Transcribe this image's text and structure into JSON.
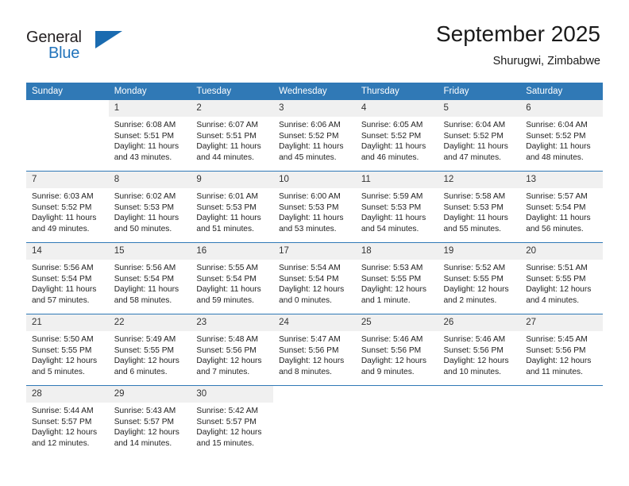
{
  "brand": {
    "name_top": "General",
    "name_bottom": "Blue",
    "color_black": "#231f20",
    "color_blue": "#2173bb"
  },
  "header": {
    "title": "September 2025",
    "subtitle": "Shurugwi, Zimbabwe"
  },
  "theme": {
    "header_bg": "#3079b6",
    "daynum_bg": "#f0f0f0",
    "grid_line": "#3079b6"
  },
  "weekday_headers": [
    "Sunday",
    "Monday",
    "Tuesday",
    "Wednesday",
    "Thursday",
    "Friday",
    "Saturday"
  ],
  "weeks": [
    [
      {
        "day": "",
        "sunrise": "",
        "sunset": "",
        "daylight1": "",
        "daylight2": ""
      },
      {
        "day": "1",
        "sunrise": "Sunrise: 6:08 AM",
        "sunset": "Sunset: 5:51 PM",
        "daylight1": "Daylight: 11 hours",
        "daylight2": "and 43 minutes."
      },
      {
        "day": "2",
        "sunrise": "Sunrise: 6:07 AM",
        "sunset": "Sunset: 5:51 PM",
        "daylight1": "Daylight: 11 hours",
        "daylight2": "and 44 minutes."
      },
      {
        "day": "3",
        "sunrise": "Sunrise: 6:06 AM",
        "sunset": "Sunset: 5:52 PM",
        "daylight1": "Daylight: 11 hours",
        "daylight2": "and 45 minutes."
      },
      {
        "day": "4",
        "sunrise": "Sunrise: 6:05 AM",
        "sunset": "Sunset: 5:52 PM",
        "daylight1": "Daylight: 11 hours",
        "daylight2": "and 46 minutes."
      },
      {
        "day": "5",
        "sunrise": "Sunrise: 6:04 AM",
        "sunset": "Sunset: 5:52 PM",
        "daylight1": "Daylight: 11 hours",
        "daylight2": "and 47 minutes."
      },
      {
        "day": "6",
        "sunrise": "Sunrise: 6:04 AM",
        "sunset": "Sunset: 5:52 PM",
        "daylight1": "Daylight: 11 hours",
        "daylight2": "and 48 minutes."
      }
    ],
    [
      {
        "day": "7",
        "sunrise": "Sunrise: 6:03 AM",
        "sunset": "Sunset: 5:52 PM",
        "daylight1": "Daylight: 11 hours",
        "daylight2": "and 49 minutes."
      },
      {
        "day": "8",
        "sunrise": "Sunrise: 6:02 AM",
        "sunset": "Sunset: 5:53 PM",
        "daylight1": "Daylight: 11 hours",
        "daylight2": "and 50 minutes."
      },
      {
        "day": "9",
        "sunrise": "Sunrise: 6:01 AM",
        "sunset": "Sunset: 5:53 PM",
        "daylight1": "Daylight: 11 hours",
        "daylight2": "and 51 minutes."
      },
      {
        "day": "10",
        "sunrise": "Sunrise: 6:00 AM",
        "sunset": "Sunset: 5:53 PM",
        "daylight1": "Daylight: 11 hours",
        "daylight2": "and 53 minutes."
      },
      {
        "day": "11",
        "sunrise": "Sunrise: 5:59 AM",
        "sunset": "Sunset: 5:53 PM",
        "daylight1": "Daylight: 11 hours",
        "daylight2": "and 54 minutes."
      },
      {
        "day": "12",
        "sunrise": "Sunrise: 5:58 AM",
        "sunset": "Sunset: 5:53 PM",
        "daylight1": "Daylight: 11 hours",
        "daylight2": "and 55 minutes."
      },
      {
        "day": "13",
        "sunrise": "Sunrise: 5:57 AM",
        "sunset": "Sunset: 5:54 PM",
        "daylight1": "Daylight: 11 hours",
        "daylight2": "and 56 minutes."
      }
    ],
    [
      {
        "day": "14",
        "sunrise": "Sunrise: 5:56 AM",
        "sunset": "Sunset: 5:54 PM",
        "daylight1": "Daylight: 11 hours",
        "daylight2": "and 57 minutes."
      },
      {
        "day": "15",
        "sunrise": "Sunrise: 5:56 AM",
        "sunset": "Sunset: 5:54 PM",
        "daylight1": "Daylight: 11 hours",
        "daylight2": "and 58 minutes."
      },
      {
        "day": "16",
        "sunrise": "Sunrise: 5:55 AM",
        "sunset": "Sunset: 5:54 PM",
        "daylight1": "Daylight: 11 hours",
        "daylight2": "and 59 minutes."
      },
      {
        "day": "17",
        "sunrise": "Sunrise: 5:54 AM",
        "sunset": "Sunset: 5:54 PM",
        "daylight1": "Daylight: 12 hours",
        "daylight2": "and 0 minutes."
      },
      {
        "day": "18",
        "sunrise": "Sunrise: 5:53 AM",
        "sunset": "Sunset: 5:55 PM",
        "daylight1": "Daylight: 12 hours",
        "daylight2": "and 1 minute."
      },
      {
        "day": "19",
        "sunrise": "Sunrise: 5:52 AM",
        "sunset": "Sunset: 5:55 PM",
        "daylight1": "Daylight: 12 hours",
        "daylight2": "and 2 minutes."
      },
      {
        "day": "20",
        "sunrise": "Sunrise: 5:51 AM",
        "sunset": "Sunset: 5:55 PM",
        "daylight1": "Daylight: 12 hours",
        "daylight2": "and 4 minutes."
      }
    ],
    [
      {
        "day": "21",
        "sunrise": "Sunrise: 5:50 AM",
        "sunset": "Sunset: 5:55 PM",
        "daylight1": "Daylight: 12 hours",
        "daylight2": "and 5 minutes."
      },
      {
        "day": "22",
        "sunrise": "Sunrise: 5:49 AM",
        "sunset": "Sunset: 5:55 PM",
        "daylight1": "Daylight: 12 hours",
        "daylight2": "and 6 minutes."
      },
      {
        "day": "23",
        "sunrise": "Sunrise: 5:48 AM",
        "sunset": "Sunset: 5:56 PM",
        "daylight1": "Daylight: 12 hours",
        "daylight2": "and 7 minutes."
      },
      {
        "day": "24",
        "sunrise": "Sunrise: 5:47 AM",
        "sunset": "Sunset: 5:56 PM",
        "daylight1": "Daylight: 12 hours",
        "daylight2": "and 8 minutes."
      },
      {
        "day": "25",
        "sunrise": "Sunrise: 5:46 AM",
        "sunset": "Sunset: 5:56 PM",
        "daylight1": "Daylight: 12 hours",
        "daylight2": "and 9 minutes."
      },
      {
        "day": "26",
        "sunrise": "Sunrise: 5:46 AM",
        "sunset": "Sunset: 5:56 PM",
        "daylight1": "Daylight: 12 hours",
        "daylight2": "and 10 minutes."
      },
      {
        "day": "27",
        "sunrise": "Sunrise: 5:45 AM",
        "sunset": "Sunset: 5:56 PM",
        "daylight1": "Daylight: 12 hours",
        "daylight2": "and 11 minutes."
      }
    ],
    [
      {
        "day": "28",
        "sunrise": "Sunrise: 5:44 AM",
        "sunset": "Sunset: 5:57 PM",
        "daylight1": "Daylight: 12 hours",
        "daylight2": "and 12 minutes."
      },
      {
        "day": "29",
        "sunrise": "Sunrise: 5:43 AM",
        "sunset": "Sunset: 5:57 PM",
        "daylight1": "Daylight: 12 hours",
        "daylight2": "and 14 minutes."
      },
      {
        "day": "30",
        "sunrise": "Sunrise: 5:42 AM",
        "sunset": "Sunset: 5:57 PM",
        "daylight1": "Daylight: 12 hours",
        "daylight2": "and 15 minutes."
      },
      {
        "day": "",
        "sunrise": "",
        "sunset": "",
        "daylight1": "",
        "daylight2": ""
      },
      {
        "day": "",
        "sunrise": "",
        "sunset": "",
        "daylight1": "",
        "daylight2": ""
      },
      {
        "day": "",
        "sunrise": "",
        "sunset": "",
        "daylight1": "",
        "daylight2": ""
      },
      {
        "day": "",
        "sunrise": "",
        "sunset": "",
        "daylight1": "",
        "daylight2": ""
      }
    ]
  ]
}
